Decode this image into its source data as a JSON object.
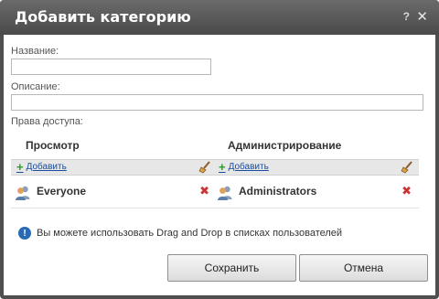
{
  "dialog": {
    "title": "Добавить категорию",
    "help_label": "?",
    "close_label": "✕"
  },
  "form": {
    "name_label": "Название:",
    "name_value": "",
    "description_label": "Описание:",
    "description_value": "",
    "access_label": "Права доступа:"
  },
  "panels": {
    "view": {
      "heading": "Просмотр",
      "add_label": "Добавить",
      "users": [
        "Everyone"
      ]
    },
    "admin": {
      "heading": "Администрирование",
      "add_label": "Добавить",
      "users": [
        "Administrators"
      ]
    }
  },
  "info_text": "Вы можете использовать Drag and Drop в списках пользователей",
  "buttons": {
    "save": "Сохранить",
    "cancel": "Отмена"
  },
  "colors": {
    "titlebar": "#4f4f4f",
    "link": "#1a4ea0",
    "remove": "#cc3333",
    "add_plus": "#2e9a2e",
    "info": "#2a6ab5"
  }
}
